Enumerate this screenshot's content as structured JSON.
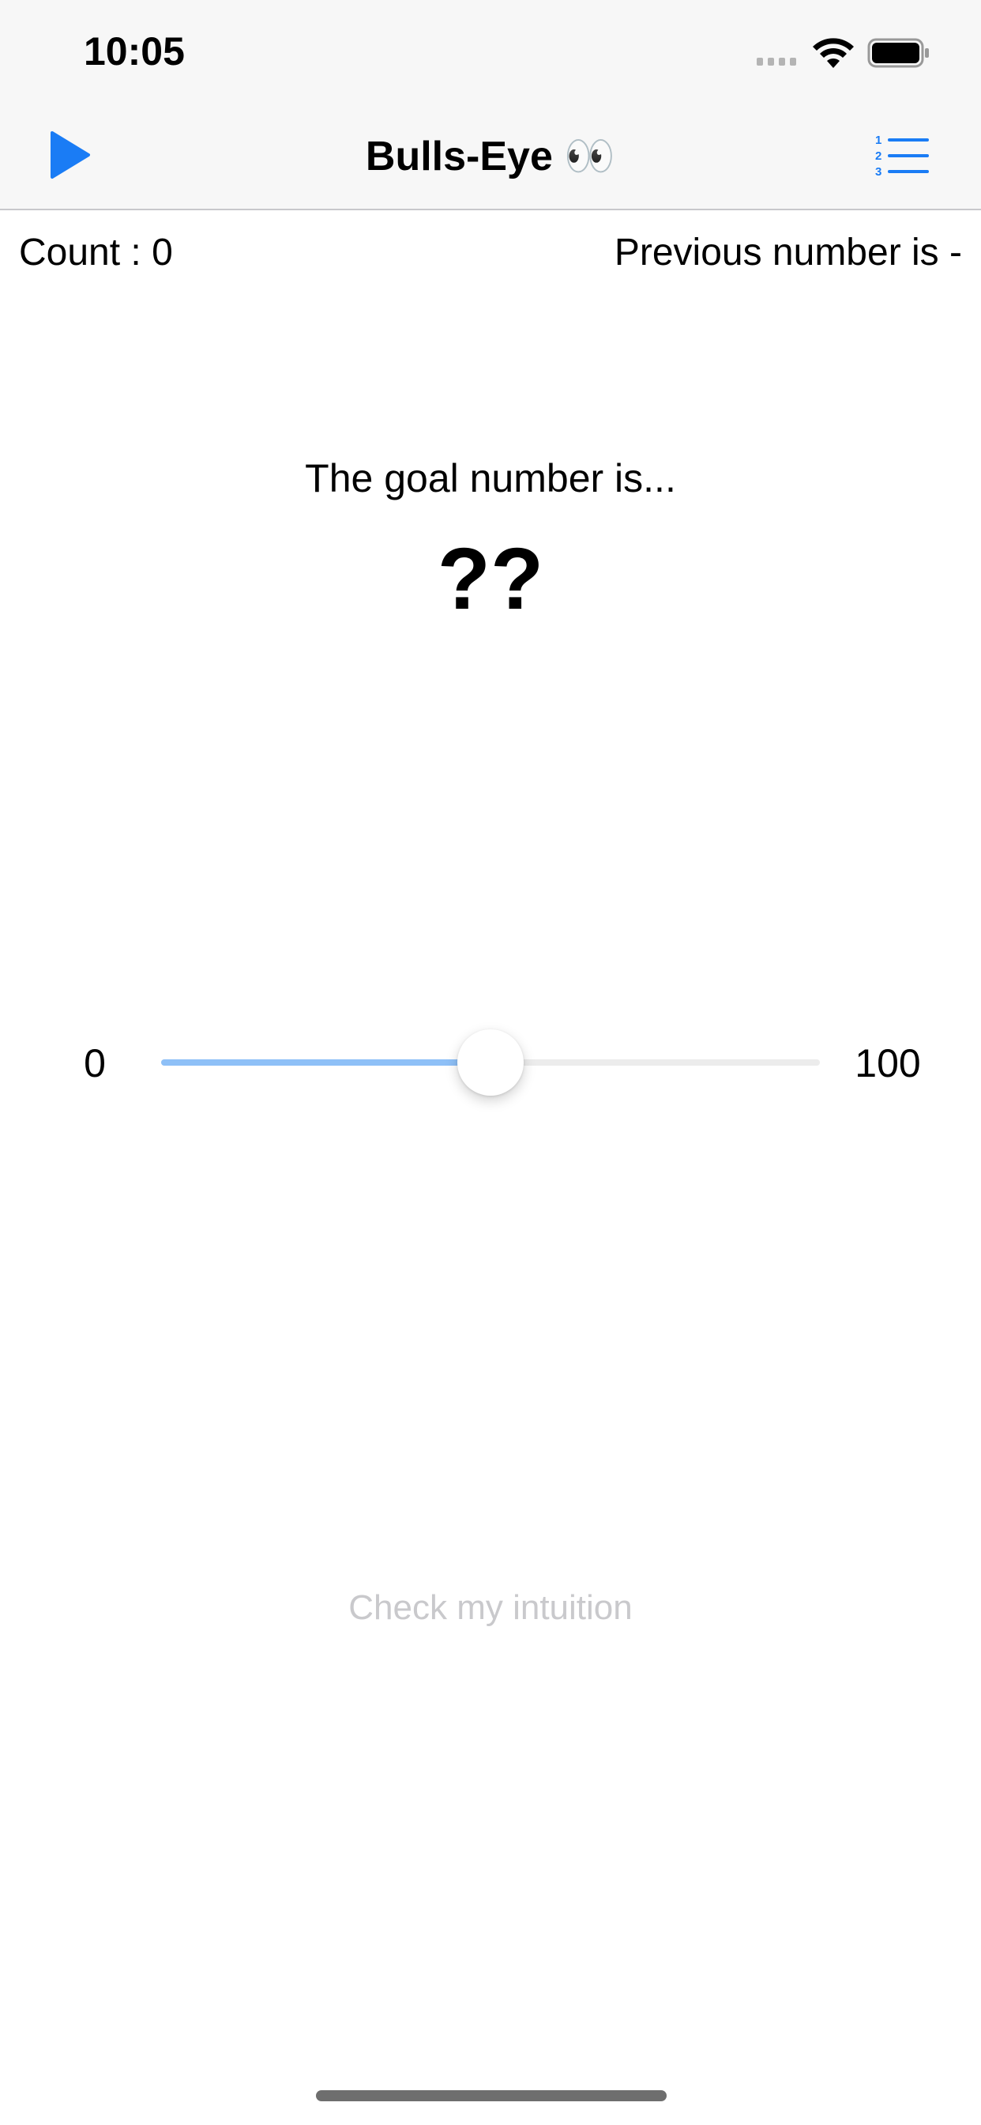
{
  "status_bar": {
    "time": "10:05",
    "icons": [
      "cellular-signal-icon",
      "wifi-icon",
      "battery-icon"
    ]
  },
  "nav_bar": {
    "title": "Bulls-Eye 👀",
    "left_icon": "play-icon",
    "right_icon": "numbered-list-icon",
    "accent_color": "#1a7cf5"
  },
  "header": {
    "count_label": "Count :  0",
    "previous_label": "Previous number is  -"
  },
  "goal": {
    "label": "The goal number is...",
    "value": "??"
  },
  "slider": {
    "min_label": "0",
    "max_label": "100",
    "value": 50,
    "min": 0,
    "max": 100,
    "fill_color": "#8ec0f7",
    "track_color": "#ececec"
  },
  "actions": {
    "check_label": "Check my intuition",
    "check_enabled": false
  }
}
